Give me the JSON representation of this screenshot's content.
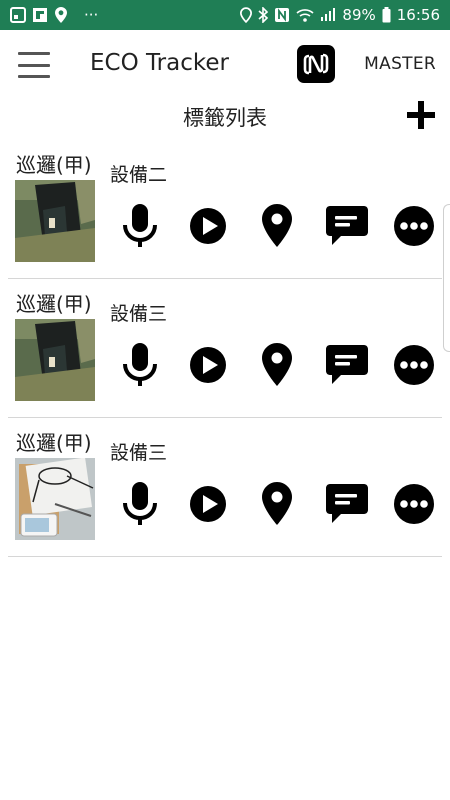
{
  "status_bar": {
    "battery": "89%",
    "time": "16:56",
    "more": "···"
  },
  "app_bar": {
    "title": "ECO Tracker",
    "master_label": "MASTER"
  },
  "list": {
    "title": "標籤列表"
  },
  "tags": [
    {
      "patrol": "巡邏(甲)",
      "device": "設備二",
      "thumb": "dark-room"
    },
    {
      "patrol": "巡邏(甲)",
      "device": "設備三",
      "thumb": "dark-room"
    },
    {
      "patrol": "巡邏(甲)",
      "device": "設備三",
      "thumb": "desk-glasses"
    }
  ],
  "colors": {
    "status_bar": "#1f7e55",
    "icon": "#000000",
    "divider": "#d6d6d6"
  },
  "icons": [
    "menu-icon",
    "nfc-icon",
    "plus-icon",
    "microphone-icon",
    "play-icon",
    "location-pin-icon",
    "comment-icon",
    "more-icon"
  ]
}
